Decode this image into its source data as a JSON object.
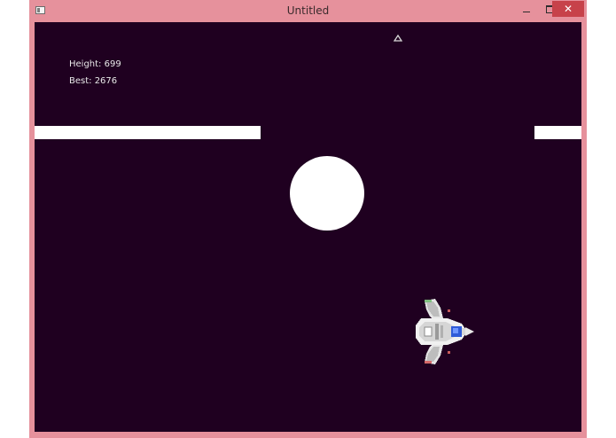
{
  "window": {
    "title": "Untitled",
    "frame_color": "#e6919c",
    "close_color": "#c7424a",
    "controls": {
      "minimize_icon": "minimize-icon",
      "maximize_icon": "maximize-icon",
      "close_glyph": "✕"
    }
  },
  "game": {
    "background_color": "#1f0020",
    "hud": {
      "height_text": "Height: 699",
      "best_text": "Best: 2676"
    },
    "objects": {
      "platform_color": "#ffffff",
      "ball_color": "#ffffff",
      "marker_icon": "up-arrow-outline-icon",
      "player_icon": "spaceship-icon",
      "ship_accent_color": "#2f5bd8"
    }
  }
}
